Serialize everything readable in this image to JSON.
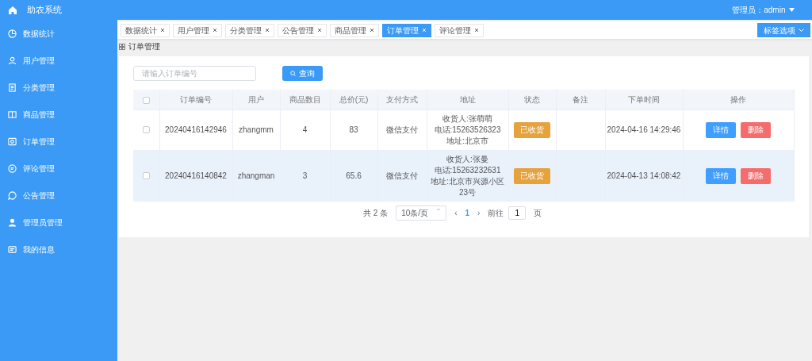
{
  "app": {
    "title": "助农系统",
    "user_menu": "管理员：admin"
  },
  "sidebar": {
    "items": [
      {
        "label": "数据统计",
        "kind": "pie"
      },
      {
        "label": "用户管理",
        "kind": "user"
      },
      {
        "label": "分类管理",
        "kind": "doc"
      },
      {
        "label": "商品管理",
        "kind": "book"
      },
      {
        "label": "订单管理",
        "kind": "order"
      },
      {
        "label": "评论管理",
        "kind": "comment"
      },
      {
        "label": "公告管理",
        "kind": "chat"
      },
      {
        "label": "管理员管理",
        "kind": "person"
      },
      {
        "label": "我的信息",
        "kind": "card"
      }
    ]
  },
  "tabs": [
    {
      "label": "数据统计",
      "selected": false
    },
    {
      "label": "用户管理",
      "selected": false
    },
    {
      "label": "分类管理",
      "selected": false
    },
    {
      "label": "公告管理",
      "selected": false
    },
    {
      "label": "商品管理",
      "selected": false
    },
    {
      "label": "订单管理",
      "selected": true
    },
    {
      "label": "评论管理",
      "selected": false
    }
  ],
  "tab_options": "标签选项",
  "breadcrumb": "订单管理",
  "search": {
    "placeholder": "请输入订单编号",
    "button": "查询"
  },
  "table": {
    "select_all_checked": false,
    "columns": [
      "订单编号",
      "用户",
      "商品数目",
      "总价(元)",
      "支付方式",
      "地址",
      "状态",
      "备注",
      "下单时间",
      "操作"
    ],
    "rows": [
      {
        "checked": false,
        "hovered": false,
        "order_no": "20240416142946",
        "user": "zhangmm",
        "count": "4",
        "total": "83",
        "payment": "微信支付",
        "address": [
          "收货人:张萌萌",
          "电话:15263526323",
          "地址:北京市"
        ],
        "status": "已收货",
        "time": "2024-04-16 14:29:46",
        "actions": [
          "详情",
          "删除"
        ]
      },
      {
        "checked": false,
        "hovered": true,
        "order_no": "20240416140842",
        "user": "zhangman",
        "count": "3",
        "total": "65.6",
        "payment": "微信支付",
        "address": [
          "收货人:张曼",
          "电话:15263232631",
          "地址:北京市兴源小区23号"
        ],
        "status": "已收货",
        "time": "2024-04-13 14:08:42",
        "actions": [
          "详情",
          "删除"
        ]
      }
    ]
  },
  "pagination": {
    "total": "共 2 条",
    "page_size": "10条/页",
    "prev": "‹",
    "pages": [
      {
        "label": "1",
        "selected": true
      }
    ],
    "next": "›",
    "goto_label": "前往",
    "goto_value": "1",
    "goto_suffix": "页"
  }
}
